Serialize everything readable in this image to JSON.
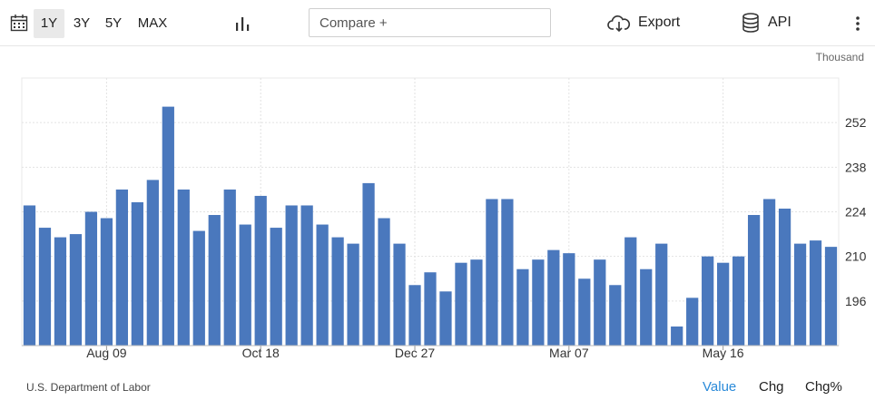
{
  "toolbar": {
    "ranges": [
      "1Y",
      "3Y",
      "5Y",
      "MAX"
    ],
    "active_range": "1Y",
    "compare_placeholder": "Compare +",
    "export_label": "Export",
    "api_label": "API"
  },
  "unit_label": "Thousand",
  "source": "U.S. Department of Labor",
  "views": [
    "Value",
    "Chg",
    "Chg%"
  ],
  "active_view": "Value",
  "colors": {
    "bar": "#4a78bd",
    "active_link": "#2a8ad9"
  },
  "chart_data": {
    "type": "bar",
    "ylim": [
      182,
      266
    ],
    "yticks": [
      196,
      210,
      224,
      238,
      252
    ],
    "xticks": [
      "Aug 09",
      "Oct 18",
      "Dec 27",
      "Mar 07",
      "May 16"
    ],
    "xtick_index": [
      5,
      15,
      25,
      35,
      45
    ],
    "values": [
      226,
      219,
      216,
      217,
      224,
      222,
      231,
      227,
      234,
      257,
      231,
      218,
      223,
      231,
      220,
      229,
      219,
      226,
      226,
      220,
      216,
      214,
      233,
      222,
      214,
      201,
      205,
      199,
      208,
      209,
      228,
      228,
      206,
      209,
      212,
      211,
      203,
      209,
      201,
      216,
      206,
      214,
      188,
      197,
      210,
      208,
      210,
      223,
      228,
      225,
      214,
      215,
      213
    ],
    "grid": true,
    "legend": "none"
  }
}
